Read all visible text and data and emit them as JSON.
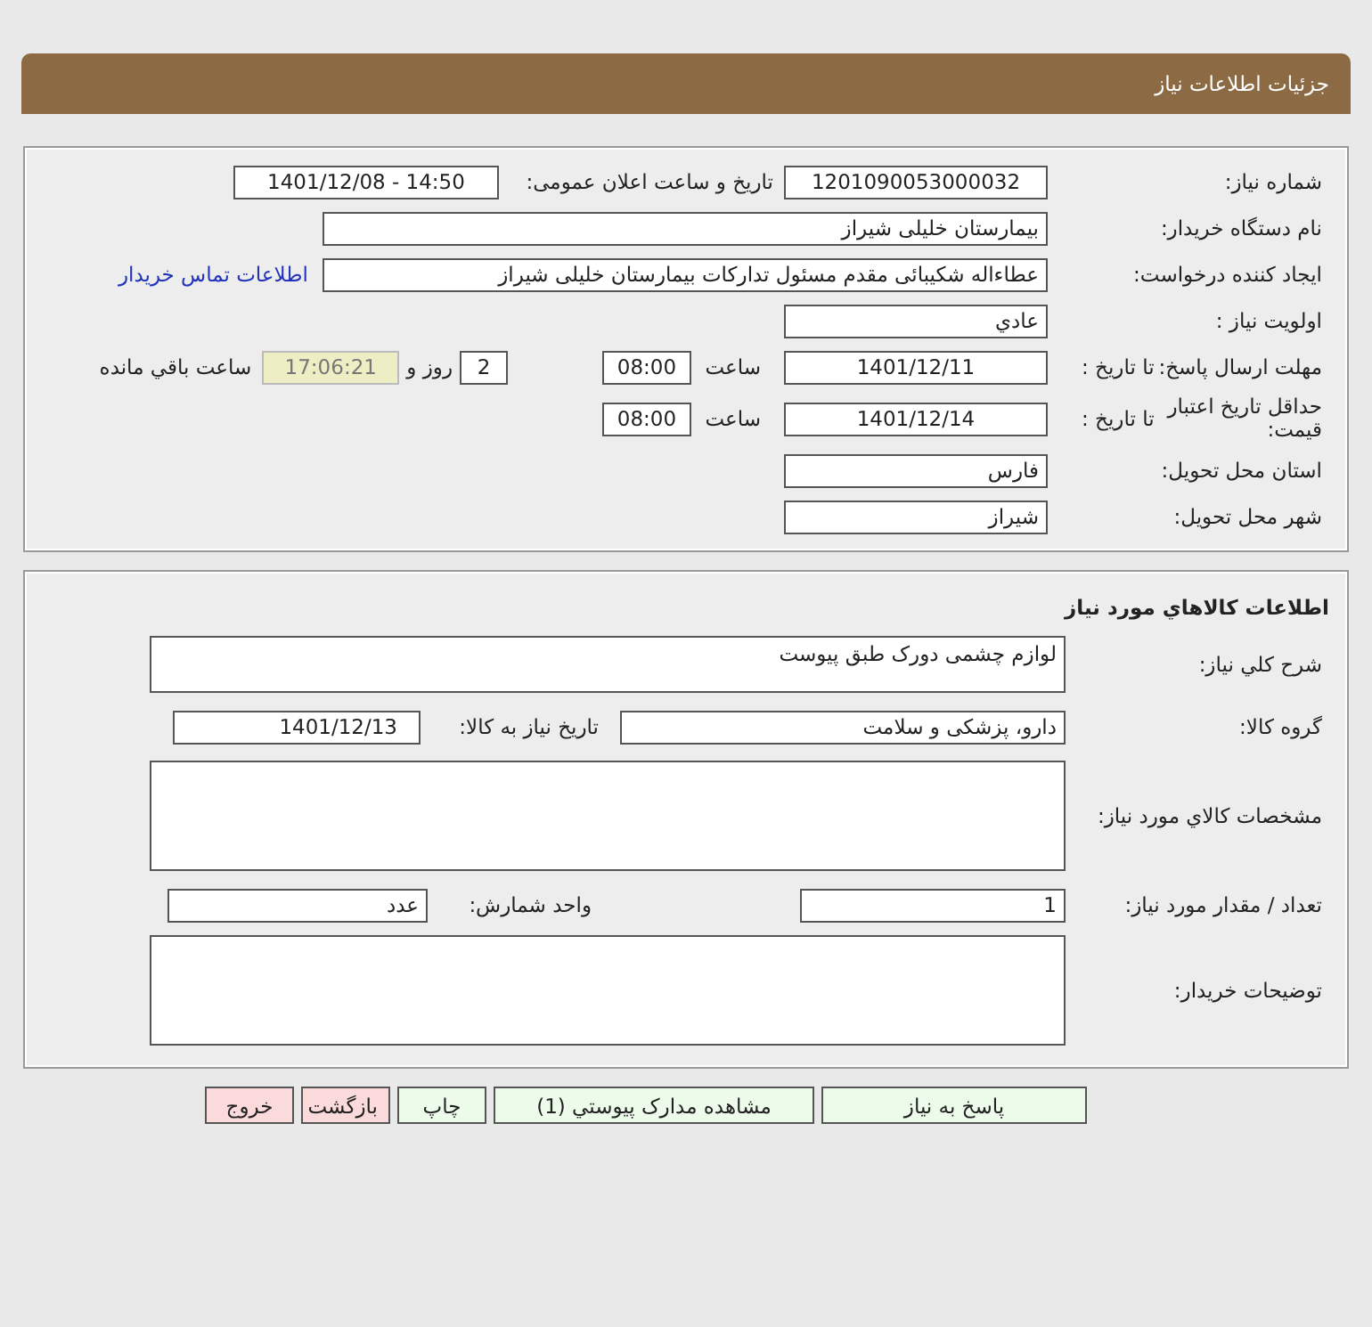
{
  "header": {
    "title": "جزئیات اطلاعات نیاز"
  },
  "need_info": {
    "need_number": {
      "label": "شماره نیاز:",
      "value": "1201090053000032"
    },
    "announce": {
      "label": "تاریخ و ساعت اعلان عمومی:",
      "value": "1401/12/08 - 14:50"
    },
    "buyer_org": {
      "label": "نام دستگاه خریدار:",
      "value": "بیمارستان خلیلی شیراز"
    },
    "creator": {
      "label": "ایجاد کننده درخواست:",
      "value": "عطاءاله شکیبائی مقدم مسئول تدارکات  بیمارستان خلیلی شیراز",
      "link": "اطلاعات تماس خریدار"
    },
    "priority": {
      "label": "اولویت نیاز :",
      "value": "عادي"
    },
    "reply_deadline": {
      "label": "مهلت ارسال پاسخ:",
      "to_date_label": "تا تاریخ :",
      "date": "1401/12/11",
      "time_label": "ساعت",
      "time": "08:00",
      "days": "2",
      "days_label": "روز و",
      "remaining": "17:06:21",
      "remaining_label": "ساعت باقي مانده"
    },
    "price_validity": {
      "label": "حداقل تاریخ اعتبار قیمت:",
      "to_date_label": "تا تاریخ :",
      "date": "1401/12/14",
      "time_label": "ساعت",
      "time": "08:00"
    },
    "province": {
      "label": "استان محل تحویل:",
      "value": "فارس"
    },
    "city": {
      "label": "شهر محل تحویل:",
      "value": "شیراز"
    }
  },
  "goods_info": {
    "title": "اطلاعات کالاهاي مورد نیاز",
    "description": {
      "label": "شرح کلي نیاز:",
      "value": "لوازم چشمی دورک طبق پیوست"
    },
    "group": {
      "label": "گروه کالا:",
      "value": "دارو، پزشکی و سلامت",
      "date_label": "تاریخ نیاز به کالا:",
      "date": "1401/12/13"
    },
    "specs": {
      "label": "مشخصات کالاي مورد نیاز:"
    },
    "quantity": {
      "label": "تعداد / مقدار مورد نیاز:",
      "value": "1",
      "unit_label": "واحد شمارش:",
      "unit": "عدد"
    },
    "buyer_notes": {
      "label": "توضیحات خریدار:"
    }
  },
  "buttons": [
    {
      "label": "پاسخ به نیاز",
      "kind": "primary"
    },
    {
      "label": "مشاهده مدارک پیوستي (1)",
      "kind": "primary"
    },
    {
      "label": "چاپ",
      "kind": "primary"
    },
    {
      "label": "بازگشت",
      "kind": "danger"
    },
    {
      "label": "خروج",
      "kind": "danger"
    }
  ]
}
